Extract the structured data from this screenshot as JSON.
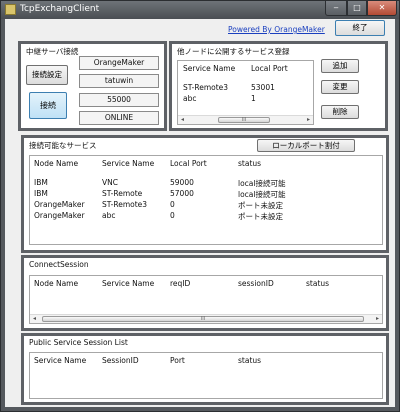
{
  "window": {
    "title": "TcpExchangClient",
    "min_glyph": "‒",
    "max_glyph": "□",
    "close_glyph": "✕"
  },
  "topbar": {
    "powered_by": "Powered By OrangeMaker",
    "exit_label": "終了"
  },
  "relay": {
    "title": "中継サーバ接続",
    "settings_label": "接続設定",
    "connect_label": "接続",
    "host": "OrangeMaker",
    "user": "tatuwin",
    "port": "55000",
    "status": "ONLINE"
  },
  "publish": {
    "title": "他ノードに公開するサービス登録",
    "columns": [
      "Service Name",
      "Local Port"
    ],
    "rows": [
      [
        "ST-Remote3",
        "53001"
      ],
      [
        "abc",
        "1"
      ]
    ],
    "add_label": "追加",
    "change_label": "変更",
    "delete_label": "削除"
  },
  "available": {
    "title": "接続可能なサービス",
    "assign_label": "ローカルポート割付",
    "columns": [
      "Node Name",
      "Service Name",
      "Local Port",
      "status"
    ],
    "rows": [
      [
        "IBM",
        "VNC",
        "59000",
        "local接続可能"
      ],
      [
        "IBM",
        "ST-Remote",
        "57000",
        "local接続可能"
      ],
      [
        "OrangeMaker",
        "ST-Remote3",
        "0",
        "ポート未設定"
      ],
      [
        "OrangeMaker",
        "abc",
        "0",
        "ポート未設定"
      ]
    ]
  },
  "connect_session": {
    "title": "ConnectSession",
    "columns": [
      "Node Name",
      "Service Name",
      "reqID",
      "sessionID",
      "status"
    ]
  },
  "public_session": {
    "title": "Public Service Session List",
    "columns": [
      "Service Name",
      "SessionID",
      "Port",
      "status"
    ]
  },
  "scroll": {
    "left_glyph": "◂",
    "right_glyph": "▸",
    "thumb_glyph": "III"
  }
}
